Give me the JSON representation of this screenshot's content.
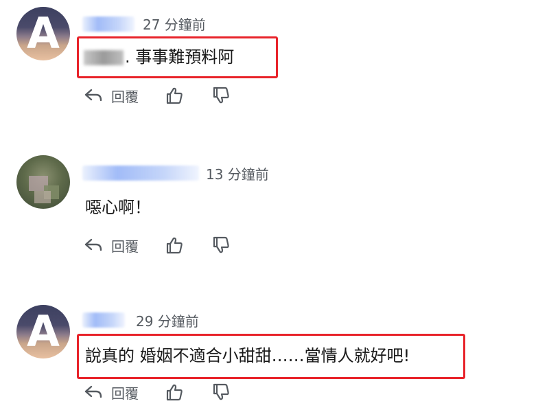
{
  "comments": [
    {
      "avatar_letter": "A",
      "time": "27 分鐘前",
      "text_suffix": ". 事事難預料阿",
      "reply_label": "回覆",
      "highlighted": true
    },
    {
      "avatar_letter": "",
      "time": "13 分鐘前",
      "text": "噁心啊！",
      "reply_label": "回覆",
      "highlighted": false
    },
    {
      "avatar_letter": "A",
      "time": "29 分鐘前",
      "text": "說真的 婚姻不適合小甜甜……當情人就好吧!",
      "reply_label": "回覆",
      "highlighted": true
    }
  ],
  "icons": {
    "reply": "reply-arrow-icon",
    "like": "thumbs-up-icon",
    "dislike": "thumbs-down-icon"
  },
  "colors": {
    "highlight_border": "#e8232a",
    "meta_text": "#555a60",
    "body_text": "#1a1a1a",
    "name_blur": "#82a5f5"
  }
}
